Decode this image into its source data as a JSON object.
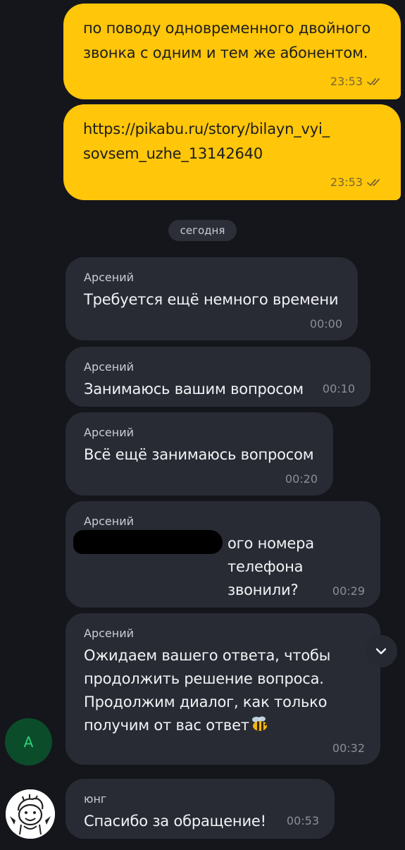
{
  "outgoing": [
    {
      "text": "по поводу одновременного двойного звонка с одним и тем же абонентом.",
      "time": "23:53",
      "status_icon": "double-check-icon"
    },
    {
      "text": "https://pikabu.ru/story/bilayn_vyi_sovsem_uzhe_13142640",
      "time": "23:53",
      "status_icon": "double-check-icon"
    }
  ],
  "date_separator": "сегодня",
  "incoming": [
    {
      "sender": "Арсений",
      "text": "Требуется ещё немного времени",
      "time": "00:00"
    },
    {
      "sender": "Арсений",
      "text": "Занимаюсь вашим вопросом",
      "time": "00:10"
    },
    {
      "sender": "Арсений",
      "text": "Всё ещё занимаюсь вопросом",
      "time": "00:20"
    },
    {
      "sender": "Арсений",
      "text": "ого номера телефона звонили?",
      "time": "00:29",
      "redacted": true
    },
    {
      "sender": "Арсений",
      "text": "Ожидаем вашего ответа, чтобы продолжить решение вопроса. Продолжим диалог, как только получим от вас ответ",
      "time": "00:32",
      "emoji": "bee-emoji"
    },
    {
      "sender": "юнг",
      "text": "Спасибо за обращение!",
      "time": "00:53"
    }
  ],
  "avatars": {
    "operator_initial": "A",
    "operator_bg": "#0b4d2a",
    "operator_fg": "#2fd37a"
  },
  "colors": {
    "outgoing_bubble": "#ffc60a",
    "incoming_bubble": "#282b34",
    "background": "#14161b"
  },
  "scroll_button_icon": "chevron-down-icon"
}
